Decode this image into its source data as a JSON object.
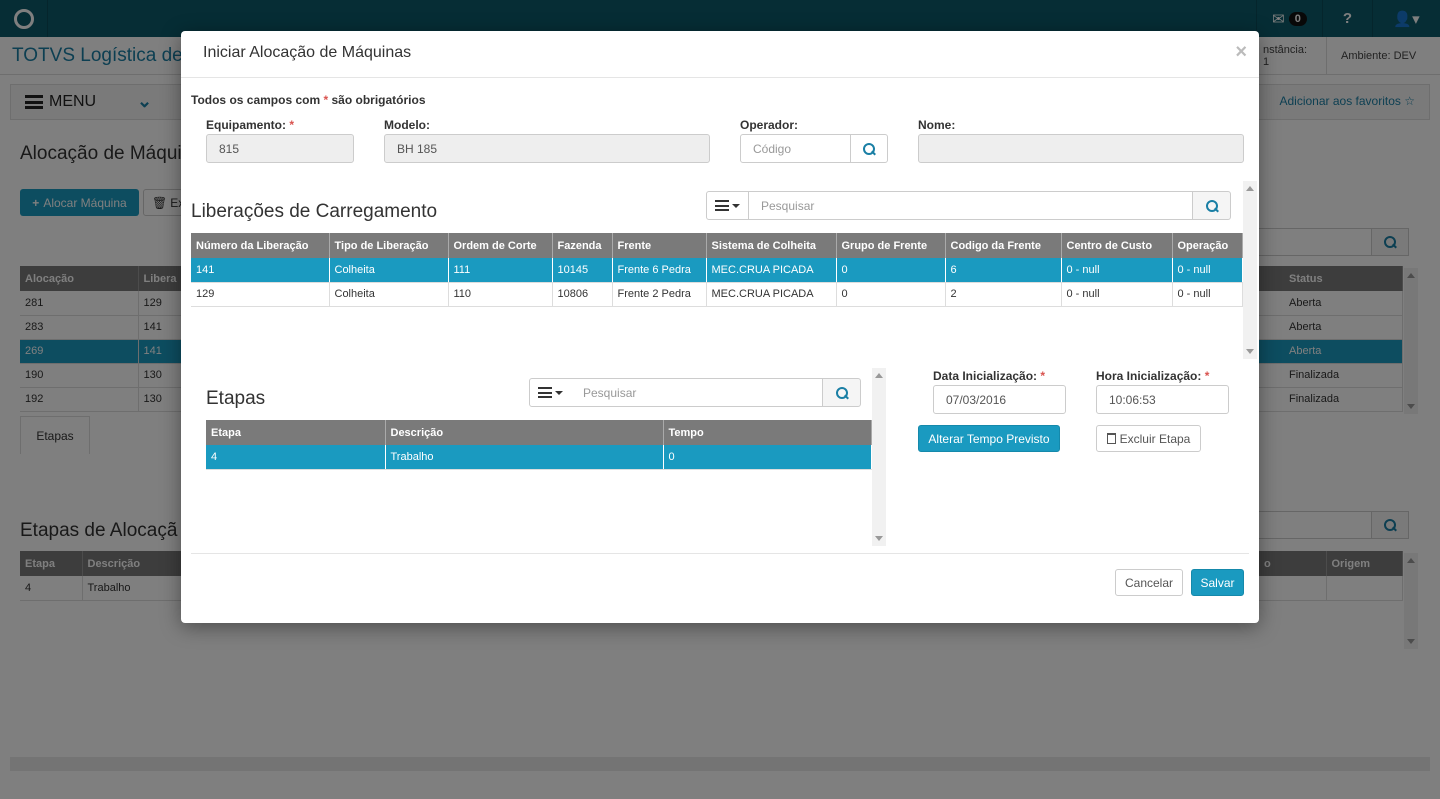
{
  "topbar": {
    "mail_count": "0"
  },
  "appbar": {
    "title": "TOTVS Logística de",
    "instance": "nstância: 1",
    "environment": "Ambiente: DEV"
  },
  "menubar": {
    "menu_label": "MENU",
    "favorites_label": "Adicionar aos favoritos ☆"
  },
  "background": {
    "page_title": "Alocação de Máqui",
    "alocar_button": "Alocar Máquina",
    "excluir_button": "Ex",
    "main_columns": [
      "Alocação",
      "Libera"
    ],
    "main_rows": [
      [
        "281",
        "129"
      ],
      [
        "283",
        "141"
      ],
      [
        "269",
        "141"
      ],
      [
        "190",
        "130"
      ],
      [
        "192",
        "130"
      ]
    ],
    "status_header": "Status",
    "status_rows": [
      "Aberta",
      "Aberta",
      "Aberta",
      "Finalizada",
      "Finalizada"
    ],
    "tab_label": "Etapas",
    "etapas_title": "Etapas de Alocaçã",
    "etapas_columns": [
      "Etapa",
      "Descrição"
    ],
    "etapas_rows": [
      [
        "4",
        "Trabalho"
      ]
    ],
    "etapas_right_columns": [
      "o",
      "Origem"
    ]
  },
  "modal": {
    "title": "Iniciar Alocação de Máquinas",
    "close": "×",
    "required_prefix": "Todos os campos com",
    "required_star": "*",
    "required_suffix": "são obrigatórios",
    "fields": {
      "equipamento_label": "Equipamento:",
      "equipamento_value": "815",
      "modelo_label": "Modelo:",
      "modelo_value": "BH 185",
      "operador_label": "Operador:",
      "operador_placeholder": "Código",
      "nome_label": "Nome:",
      "nome_value": ""
    },
    "liberacoes": {
      "title": "Liberações de Carregamento",
      "search_placeholder": "Pesquisar",
      "columns": [
        "Número da Liberação",
        "Tipo de Liberação",
        "Ordem de Corte",
        "Fazenda",
        "Frente",
        "Sistema de Colheita",
        "Grupo de Frente",
        "Codigo da Frente",
        "Centro de Custo",
        "Operação"
      ],
      "rows": [
        [
          "141",
          "Colheita",
          "111",
          "10145",
          "Frente 6 Pedra",
          "MEC.CRUA PICADA",
          "0",
          "6",
          "0 - null",
          "0 - null"
        ],
        [
          "129",
          "Colheita",
          "110",
          "10806",
          "Frente 2 Pedra",
          "MEC.CRUA PICADA",
          "0",
          "2",
          "0 - null",
          "0 - null"
        ]
      ],
      "selected_row": 0
    },
    "etapas": {
      "title": "Etapas",
      "search_placeholder": "Pesquisar",
      "columns": [
        "Etapa",
        "Descrição",
        "Tempo"
      ],
      "rows": [
        [
          "4",
          "Trabalho",
          "0"
        ]
      ],
      "selected_row": 0
    },
    "inicializacao": {
      "data_label": "Data Inicialização:",
      "data_value": "07/03/2016",
      "hora_label": "Hora Inicialização:",
      "hora_value": "10:06:53",
      "alterar_button": "Alterar Tempo Previsto",
      "excluir_button": "Excluir Etapa"
    },
    "footer": {
      "cancel": "Cancelar",
      "save": "Salvar"
    }
  },
  "colors": {
    "accent": "#1a9ac0",
    "topbar": "#0d5b6b",
    "header_grid": "#7a7a7a",
    "required": "#d9534f"
  }
}
